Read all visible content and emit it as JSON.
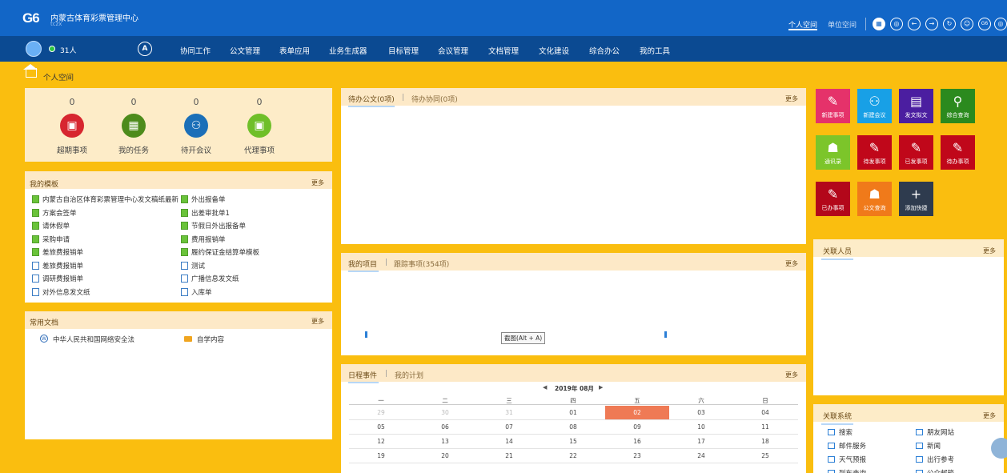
{
  "header": {
    "logo_text": "G6",
    "org_name": "内蒙古体育彩票管理中心",
    "org_sub": "tczx",
    "links": [
      "个人空间",
      "单位空间"
    ],
    "icons": [
      "apps-icon",
      "target-icon",
      "back-icon",
      "forward-icon",
      "refresh-icon",
      "chat-icon",
      "g6-icon",
      "more-icon"
    ]
  },
  "nav": {
    "online_count": "31人",
    "circle_label": "A",
    "items": [
      "协同工作",
      "公文管理",
      "表单应用",
      "业务生成器",
      "目标管理",
      "会议管理",
      "文档管理",
      "文化建设",
      "综合办公",
      "我的工具"
    ]
  },
  "breadcrumb": "个人空间",
  "stats": [
    {
      "count": "0",
      "label": "超期事项",
      "color": "#d7262f",
      "icon": "clock-doc-icon"
    },
    {
      "count": "0",
      "label": "我的任务",
      "color": "#4d8b1c",
      "icon": "calendar-icon"
    },
    {
      "count": "0",
      "label": "待开会议",
      "color": "#1b6fb8",
      "icon": "people-icon"
    },
    {
      "count": "0",
      "label": "代理事项",
      "color": "#6fbf29",
      "icon": "proxy-doc-icon"
    }
  ],
  "templates": {
    "title": "我的模板",
    "more": "更多",
    "left": [
      {
        "label": "内蒙古自治区体育彩票管理中心发文稿纸最新",
        "type": "green"
      },
      {
        "label": "方案会签单",
        "type": "green"
      },
      {
        "label": "请休假单",
        "type": "green"
      },
      {
        "label": "采购申请",
        "type": "green"
      },
      {
        "label": "差旅费报销单",
        "type": "green"
      },
      {
        "label": "差旅费报销单",
        "type": "blue"
      },
      {
        "label": "调研费报销单",
        "type": "blue"
      },
      {
        "label": "对外信息发文纸",
        "type": "blue"
      }
    ],
    "right": [
      {
        "label": "外出报备单",
        "type": "green"
      },
      {
        "label": "出差审批单1",
        "type": "green"
      },
      {
        "label": "节假日外出报备单",
        "type": "green"
      },
      {
        "label": "费用报销单",
        "type": "green"
      },
      {
        "label": "履约保证金结算单模板",
        "type": "green"
      },
      {
        "label": "测试",
        "type": "blue"
      },
      {
        "label": "广播信息发文纸",
        "type": "blue"
      },
      {
        "label": "入库单",
        "type": "blue"
      }
    ]
  },
  "docs": {
    "title": "常用文档",
    "more": "更多",
    "items": [
      "中华人民共和国网络安全法",
      "自学内容"
    ]
  },
  "pending": {
    "tab_active": "待办公文(0项)",
    "tab_other": "待办协同(0项)",
    "more": "更多"
  },
  "project": {
    "tab_active": "我的项目",
    "tab_other": "跟踪事项(354项)",
    "more": "更多",
    "tooltip": "截图(Alt + A)"
  },
  "schedule": {
    "tab_active": "日程事件",
    "tab_other": "我的计划",
    "more": "更多",
    "month": "2019年 08月",
    "weekdays": [
      "一",
      "二",
      "三",
      "四",
      "五",
      "六",
      "日"
    ],
    "rows": [
      [
        "29",
        "30",
        "31",
        "01",
        "02",
        "03",
        "04"
      ],
      [
        "05",
        "06",
        "07",
        "08",
        "09",
        "10",
        "11"
      ],
      [
        "12",
        "13",
        "14",
        "15",
        "16",
        "17",
        "18"
      ],
      [
        "19",
        "20",
        "21",
        "22",
        "23",
        "24",
        "25"
      ]
    ]
  },
  "tiles": [
    {
      "label": "新建事项",
      "color": "#e5326a",
      "icon": "new-item-icon",
      "glyph": "✎"
    },
    {
      "label": "新建会议",
      "color": "#18a0e6",
      "icon": "new-meeting-icon",
      "glyph": "⚇"
    },
    {
      "label": "发文拟文",
      "color": "#4b1ea0",
      "icon": "draft-icon",
      "glyph": "▤"
    },
    {
      "label": "综合查询",
      "color": "#2b8a1e",
      "icon": "search-icon",
      "glyph": "⚲"
    },
    {
      "label": "通讯录",
      "color": "#7cc52a",
      "icon": "contacts-icon",
      "glyph": "☗"
    },
    {
      "label": "待发事项",
      "color": "#c0071a",
      "icon": "to-send-icon",
      "glyph": "✎"
    },
    {
      "label": "已发事项",
      "color": "#c0071a",
      "icon": "sent-icon",
      "glyph": "✎"
    },
    {
      "label": "待办事项",
      "color": "#c0071a",
      "icon": "todo-icon",
      "glyph": "✎"
    },
    {
      "label": "已办事项",
      "color": "#b3071a",
      "icon": "done-icon",
      "glyph": "✎"
    },
    {
      "label": "公文查询",
      "color": "#f07a1a",
      "icon": "doc-query-icon",
      "glyph": "☗"
    },
    {
      "label": "添加快捷",
      "color": "#2e3b4e",
      "icon": "add-icon",
      "glyph": "+"
    }
  ],
  "related_people": {
    "title": "关联人员",
    "more": "更多"
  },
  "related_sys": {
    "title": "关联系统",
    "more": "更多",
    "items": [
      "搜索",
      "朋友网站",
      "邮件服务",
      "新闻",
      "天气预报",
      "出行参考",
      "列车查询",
      "公众邮箱"
    ]
  }
}
